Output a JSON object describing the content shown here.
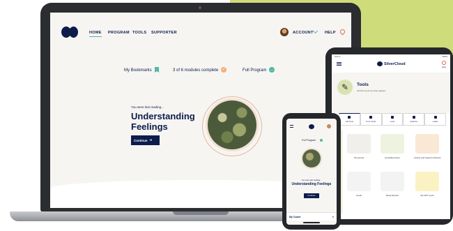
{
  "laptop": {
    "nav": {
      "home": "HOME",
      "program": "PROGRAM",
      "tools": "TOOLS",
      "supporter": "SUPPORTER",
      "account": "ACCOUNT",
      "help": "HELP"
    },
    "stats": {
      "bookmarks": "My Bookmarks",
      "modules": "3 of 6 modules complete",
      "full_program": "Full Program"
    },
    "last_reading_label": "You were last reading...",
    "last_reading_title": "Understanding Feelings",
    "continue_label": "Continue"
  },
  "tablet": {
    "status_left": "9:41 A",
    "status_right": "100%",
    "brand": "SilverCloud",
    "help_label": "Help",
    "hero": {
      "title": "Tools",
      "subtitle": "Find the tools you have gained"
    },
    "tabs": [
      {
        "label": "All Tools",
        "icon": "grid-icon"
      },
      {
        "label": "Core Tools",
        "icon": "target-icon"
      },
      {
        "label": "Lists",
        "icon": "list-icon"
      },
      {
        "label": "Quizzes",
        "icon": "quiz-icon"
      },
      {
        "label": "Audio",
        "icon": "headphones-icon"
      }
    ],
    "cards": [
      {
        "label": "My journal",
        "color": "#f0efe9",
        "icon": "journal-icon"
      },
      {
        "label": "Goals/Exercises",
        "color": "#eef3e0",
        "icon": "chart-icon"
      },
      {
        "label": "Activity and Support Network",
        "color": "#fbe7d6",
        "icon": "network-icon"
      },
      {
        "label": "Goals",
        "color": "#f3f3f3",
        "icon": "clock-icon"
      },
      {
        "label": "Mood Monitor",
        "color": "#f3f3f3",
        "icon": "weather-icon"
      },
      {
        "label": "My CBT Cycle",
        "color": "#fbf2c4",
        "icon": "cycle-icon"
      }
    ]
  },
  "phone": {
    "full_program": "Full Program",
    "last_reading_label": "You were last reading...",
    "last_reading_title": "Understanding Feelings",
    "continue_label": "Continue",
    "coach": "My Coach",
    "close": "×"
  },
  "colors": {
    "navy": "#0e1c4c",
    "teal": "#4fb8a7",
    "green_accent": "#cfdc7a",
    "peach": "#f2b07a"
  }
}
